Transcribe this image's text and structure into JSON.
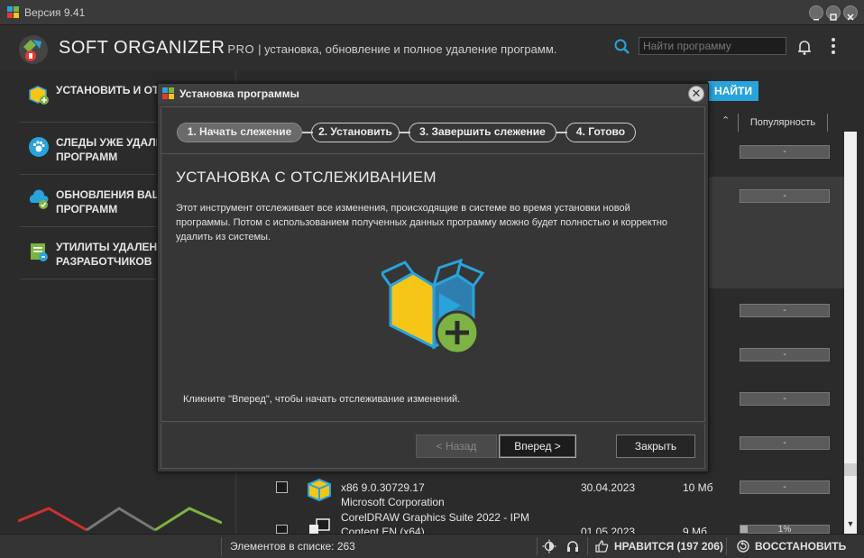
{
  "window": {
    "version_label": "Версия 9.41"
  },
  "header": {
    "brand": "SOFT ORGANIZER",
    "pro": "PRO",
    "tagline": "| установка, обновление и полное удаление программ.",
    "search_placeholder": "Найти программу",
    "find_button": "НАЙТИ"
  },
  "sidebar": {
    "items": [
      {
        "label": "УСТАНОВИТЬ И ОТС"
      },
      {
        "label": "СЛЕДЫ УЖЕ УДАЛЕ\nПРОГРАММ"
      },
      {
        "label": "ОБНОВЛЕНИЯ ВАШ\nПРОГРАММ"
      },
      {
        "label": "УТИЛИТЫ УДАЛЕН\nРАЗРАБОТЧИКОВ"
      }
    ]
  },
  "list": {
    "popularity_header": "Популярность",
    "popularity_values": [
      "-",
      "-",
      "-",
      "-",
      "-",
      "-",
      "-",
      "1%"
    ],
    "rows": [
      {
        "name": "x86 9.0.30729.17",
        "publisher": "Microsoft Corporation",
        "date": "30.04.2023",
        "size": "10 Мб"
      },
      {
        "name": "CorelDRAW Graphics Suite 2022 - IPM",
        "publisher": "Content EN (x64)",
        "date": "01.05.2023",
        "size": "9 Мб"
      }
    ]
  },
  "statusbar": {
    "count": "Элементов в списке: 263",
    "like": "НРАВИТСЯ (197 206)",
    "restore": "ВОССТАНОВИТЬ"
  },
  "modal": {
    "title": "Установка программы",
    "steps": [
      "1. Начать слежение",
      "2. Установить",
      "3. Завершить слежение",
      "4. Готово"
    ],
    "active_step": 1,
    "heading": "УСТАНОВКА С ОТСЛЕЖИВАНИЕМ",
    "description": "Этот инструмент отслеживает все изменения, происходящие в системе во время установки новой программы. Потом с использованием полученных данных программу можно будет полностью и корректно удалить из системы.",
    "hint": "Кликните \"Вперед\", чтобы начать отслеживание изменений.",
    "back_button": "< Назад",
    "next_button": "Вперед >",
    "close_button": "Закрыть"
  },
  "colors": {
    "accent": "#29a3db",
    "green": "#7cb342",
    "yellow": "#f5c518"
  }
}
